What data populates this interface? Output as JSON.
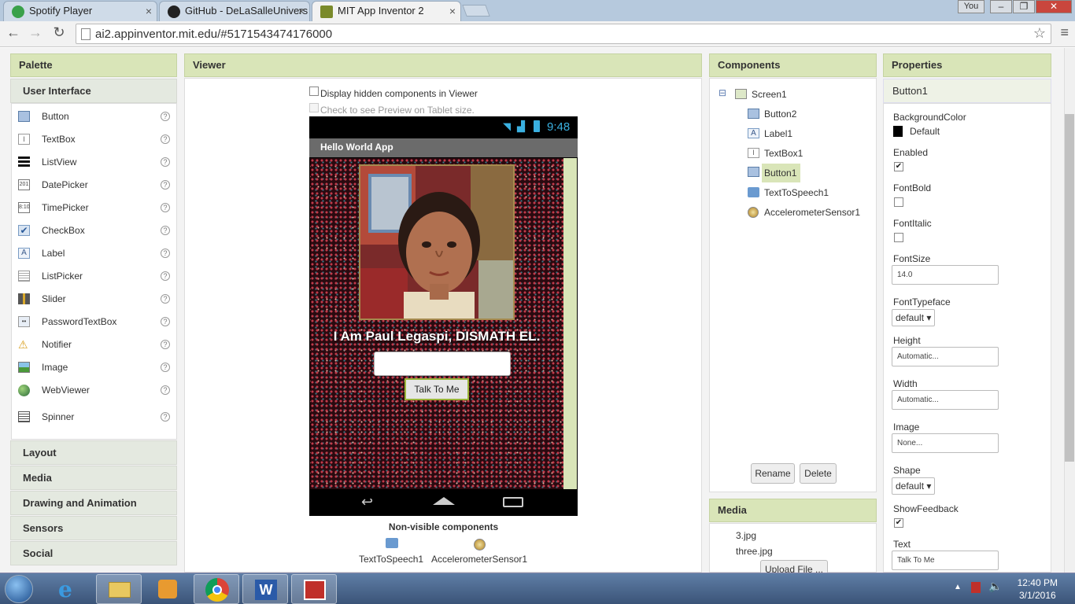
{
  "browser": {
    "tabs": [
      {
        "label": "Spotify Player",
        "icon_color": "#3aa14a"
      },
      {
        "label": "GitHub - DeLaSalleUnivers",
        "icon_color": "#222222"
      },
      {
        "label": "MIT App Inventor 2",
        "icon_color": "#7a8a2a"
      }
    ],
    "user_button": "You",
    "url": "ai2.appinventor.mit.edu/#5171543474176000",
    "window_controls": [
      "–",
      "❐",
      "✕"
    ]
  },
  "palette": {
    "title": "Palette",
    "section": "User Interface",
    "items": [
      {
        "label": "Button",
        "icon": "button-icon"
      },
      {
        "label": "TextBox",
        "icon": "textbox-icon"
      },
      {
        "label": "ListView",
        "icon": "listview-icon"
      },
      {
        "label": "DatePicker",
        "icon": "datepicker-icon"
      },
      {
        "label": "TimePicker",
        "icon": "timepicker-icon"
      },
      {
        "label": "CheckBox",
        "icon": "checkbox-icon"
      },
      {
        "label": "Label",
        "icon": "label-icon"
      },
      {
        "label": "ListPicker",
        "icon": "listpicker-icon"
      },
      {
        "label": "Slider",
        "icon": "slider-icon"
      },
      {
        "label": "PasswordTextBox",
        "icon": "passwordtextbox-icon"
      },
      {
        "label": "Notifier",
        "icon": "notifier-icon"
      },
      {
        "label": "Image",
        "icon": "image-icon"
      },
      {
        "label": "WebViewer",
        "icon": "webviewer-icon"
      },
      {
        "label": "Spinner",
        "icon": "spinner-icon"
      }
    ],
    "help_glyph": "?",
    "categories": [
      "Layout",
      "Media",
      "Drawing and Animation",
      "Sensors",
      "Social"
    ]
  },
  "viewer": {
    "title": "Viewer",
    "display_hidden": "Display hidden components in Viewer",
    "tablet_preview": "Check to see Preview on Tablet size.",
    "status_time": "9:48",
    "app_title": "Hello World App",
    "label_text": "I Am Paul Legaspi, DISMATH EL.",
    "button_text": "Talk To Me",
    "nonvisible_title": "Non-visible components",
    "nonvisible": [
      "TextToSpeech1",
      "AccelerometerSensor1"
    ]
  },
  "components": {
    "title": "Components",
    "tree": [
      {
        "label": "Screen1",
        "icon": "screen-icon",
        "collapse": "⊟"
      },
      {
        "label": "Button2",
        "icon": "button-icon"
      },
      {
        "label": "Label1",
        "icon": "label-icon"
      },
      {
        "label": "TextBox1",
        "icon": "textbox-icon"
      },
      {
        "label": "Button1",
        "icon": "button-icon",
        "selected": true
      },
      {
        "label": "TextToSpeech1",
        "icon": "speech-icon"
      },
      {
        "label": "AccelerometerSensor1",
        "icon": "accelerometer-icon"
      }
    ],
    "rename": "Rename",
    "delete": "Delete"
  },
  "media": {
    "title": "Media",
    "files": [
      "3.jpg",
      "three.jpg"
    ],
    "upload": "Upload File ..."
  },
  "properties": {
    "title": "Properties",
    "component": "Button1",
    "background_color_label": "BackgroundColor",
    "background_color_value": "Default",
    "enabled_label": "Enabled",
    "enabled": true,
    "fontbold_label": "FontBold",
    "fontbold": false,
    "fontitalic_label": "FontItalic",
    "fontitalic": false,
    "fontsize_label": "FontSize",
    "fontsize": "14.0",
    "fonttypeface_label": "FontTypeface",
    "fonttypeface": "default ▾",
    "height_label": "Height",
    "height": "Automatic...",
    "width_label": "Width",
    "width": "Automatic...",
    "image_label": "Image",
    "image": "None...",
    "shape_label": "Shape",
    "shape": "default ▾",
    "showfeedback_label": "ShowFeedback",
    "showfeedback": true,
    "text_label": "Text",
    "text": "Talk To Me",
    "check_glyph": "✔"
  },
  "taskbar": {
    "time": "12:40 PM",
    "date": "3/1/2016"
  },
  "colors": {
    "panel_header": "#d9e5b8",
    "selected": "#d9e5b8",
    "accent": "#9ab53a"
  }
}
